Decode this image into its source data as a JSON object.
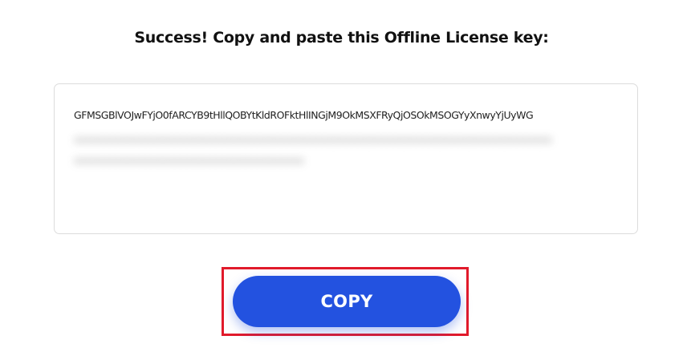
{
  "header": {
    "title": "Success! Copy and paste this Offline License key:"
  },
  "license": {
    "key_line_1": "GFMSGBlVOJwFYjO0fARCYB9tHllQOBYtKldROFktHlINGjM9OkMSXFRyQjOSOkMSOGYyXnwyYjUyWG",
    "key_line_2_obscured": "",
    "key_line_3_obscured": ""
  },
  "actions": {
    "copy_label": "COPY"
  },
  "colors": {
    "button": "#2352e0",
    "highlight": "#e11a2b"
  }
}
